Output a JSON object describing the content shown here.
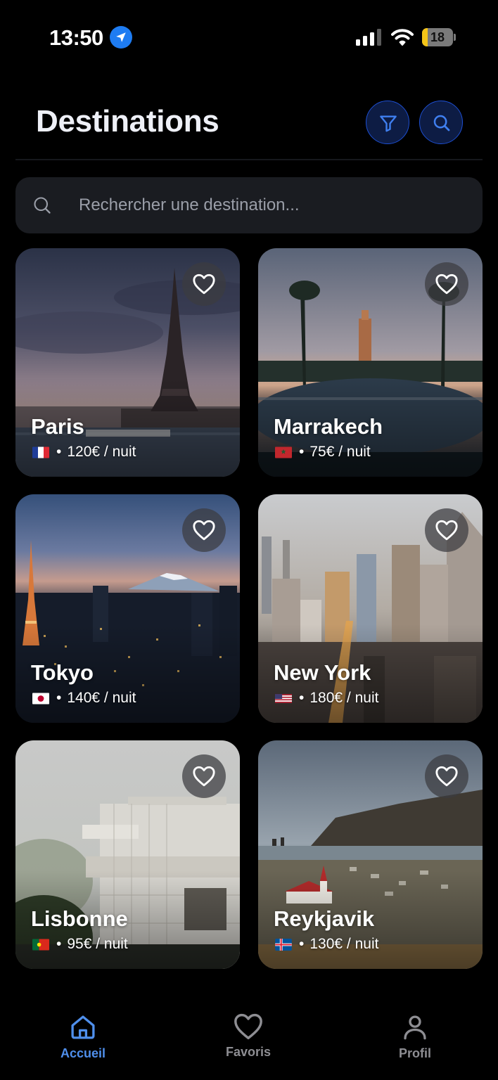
{
  "status_bar": {
    "time": "13:50",
    "battery_level": "18",
    "battery_fraction": 0.18,
    "battery_color": "#f5c518",
    "location_icon": "location-arrow-icon",
    "signal_icon": "cellular-signal-icon",
    "wifi_icon": "wifi-icon"
  },
  "header": {
    "title": "Destinations",
    "filter_icon": "filter-icon",
    "search_icon": "search-icon"
  },
  "search": {
    "placeholder": "Rechercher une destination...",
    "value": ""
  },
  "destinations": [
    {
      "name": "Paris",
      "flag": "france-flag-icon",
      "price": "120€ / nuit",
      "favorite": false
    },
    {
      "name": "Marrakech",
      "flag": "morocco-flag-icon",
      "price": "75€ / nuit",
      "favorite": false
    },
    {
      "name": "Tokyo",
      "flag": "japan-flag-icon",
      "price": "140€ / nuit",
      "favorite": false
    },
    {
      "name": "New York",
      "flag": "usa-flag-icon",
      "price": "180€ / nuit",
      "favorite": false
    },
    {
      "name": "Lisbonne",
      "flag": "portugal-flag-icon",
      "price": "95€ / nuit",
      "favorite": false
    },
    {
      "name": "Reykjavik",
      "flag": "iceland-flag-icon",
      "price": "130€ / nuit",
      "favorite": false
    }
  ],
  "separator": "•",
  "nav": {
    "items": [
      {
        "label": "Accueil",
        "icon": "home-icon",
        "active": true
      },
      {
        "label": "Favoris",
        "icon": "heart-icon",
        "active": false
      },
      {
        "label": "Profil",
        "icon": "person-icon",
        "active": false
      }
    ],
    "active_color": "#4f8fec",
    "inactive_color": "#8e8e93"
  }
}
